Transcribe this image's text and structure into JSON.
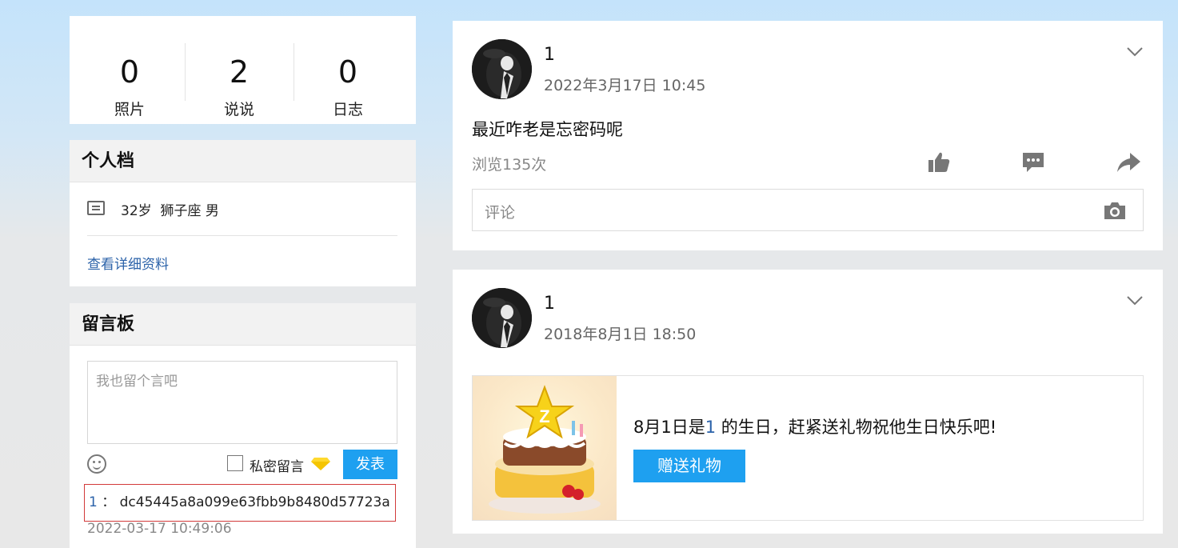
{
  "stats": [
    {
      "count": "0",
      "label": "照片"
    },
    {
      "count": "2",
      "label": "说说"
    },
    {
      "count": "0",
      "label": "日志"
    }
  ],
  "profile": {
    "title": "个人档",
    "info": "32岁  狮子座 男",
    "detail_link": "查看详细资料"
  },
  "message_board": {
    "title": "留言板",
    "placeholder": "我也留个言吧",
    "private_label": "私密留言",
    "post_label": "发表",
    "message": {
      "author": "1",
      "separator": "：",
      "text": "dc45445a8a099e63fbb9b8480d57723a"
    },
    "time": "2022-03-17 10:49:06"
  },
  "posts": [
    {
      "author": "1",
      "time": "2022年3月17日 10:45",
      "text": "最近咋老是忘密码呢",
      "views": "浏览135次",
      "comment_placeholder": "评论"
    },
    {
      "author": "1",
      "time": "2018年8月1日 18:50",
      "bday_prefix": "8月1日是",
      "bday_name": "1",
      "bday_suffix": " 的生日，赶紧送礼物祝他生日快乐吧!",
      "gift_label": "赠送礼物"
    }
  ],
  "colors": {
    "accent": "#1ea0f0",
    "link": "#2b62a9"
  },
  "icons": [
    "info-icon",
    "smile-icon",
    "diamond-icon",
    "chevron-down-icon",
    "thumbs-up-icon",
    "comment-icon",
    "share-icon",
    "camera-icon"
  ]
}
